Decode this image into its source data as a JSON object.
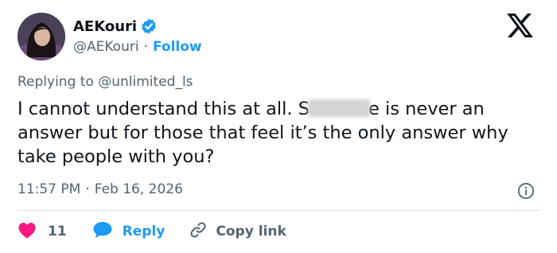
{
  "author": {
    "display_name": "AEKouri",
    "handle": "@AEKouri",
    "separator": "·",
    "follow_label": "Follow",
    "verified_color": "#1d9bf0",
    "avatar": "profile-photo"
  },
  "reply_context": {
    "prefix": "Replying to",
    "target": "@unlimited_ls"
  },
  "tweet": {
    "text_part1": "I cannot understand this at all. S",
    "text_redacted": "[blurred]",
    "text_part2": "e is never an answer but for those that feel it’s the only answer why take people with you?"
  },
  "meta": {
    "time": "11:57 PM",
    "separator": "·",
    "date": "Feb 16, 2026"
  },
  "actions": {
    "like_count": "11",
    "reply_label": "Reply",
    "copy_label": "Copy link"
  },
  "colors": {
    "accent": "#1d9bf0",
    "like": "#f91880",
    "muted": "#536471",
    "text": "#0f1419"
  },
  "icons": [
    "verified-badge-icon",
    "x-logo-icon",
    "info-icon",
    "heart-icon",
    "reply-bubble-icon",
    "link-icon"
  ]
}
